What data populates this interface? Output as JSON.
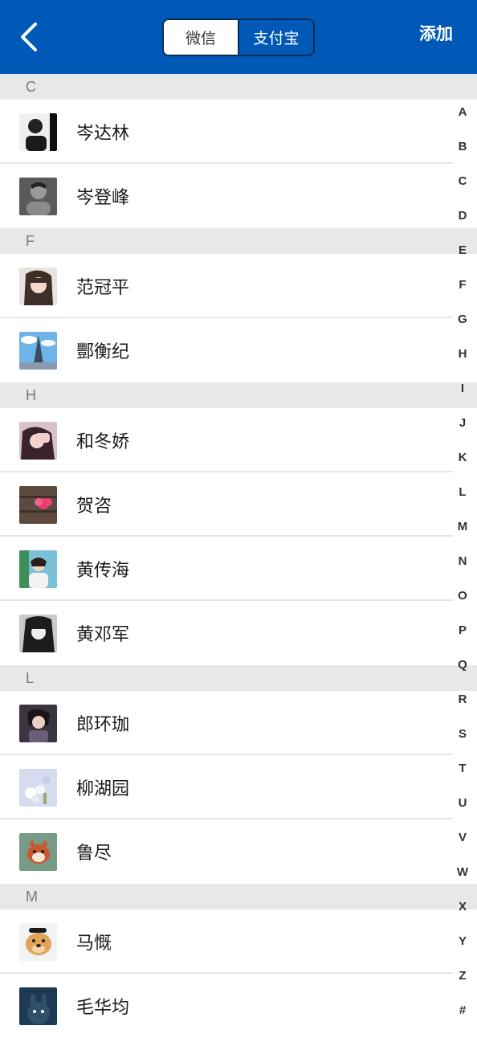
{
  "header": {
    "tabs": [
      {
        "label": "微信",
        "active": true
      },
      {
        "label": "支付宝",
        "active": false
      }
    ],
    "add_label": "添加"
  },
  "sections": [
    {
      "letter": "C",
      "contacts": [
        {
          "name": "岑达林"
        },
        {
          "name": "岑登峰"
        }
      ]
    },
    {
      "letter": "F",
      "contacts": [
        {
          "name": "范冠平"
        },
        {
          "name": "酆衡纪"
        }
      ]
    },
    {
      "letter": "H",
      "contacts": [
        {
          "name": "和冬娇"
        },
        {
          "name": "贺咨"
        },
        {
          "name": "黄传海"
        },
        {
          "name": "黄邓军"
        }
      ]
    },
    {
      "letter": "L",
      "contacts": [
        {
          "name": "郎环珈"
        },
        {
          "name": "柳湖园"
        },
        {
          "name": "鲁尽"
        }
      ]
    },
    {
      "letter": "M",
      "contacts": [
        {
          "name": "马慨"
        },
        {
          "name": "毛华均"
        }
      ]
    }
  ],
  "index_letters": [
    "A",
    "B",
    "C",
    "D",
    "E",
    "F",
    "G",
    "H",
    "I",
    "J",
    "K",
    "L",
    "M",
    "N",
    "O",
    "P",
    "Q",
    "R",
    "S",
    "T",
    "U",
    "V",
    "W",
    "X",
    "Y",
    "Z",
    "#"
  ],
  "colors": {
    "header": "#0058b7",
    "section_bg": "#e8e8e8"
  }
}
